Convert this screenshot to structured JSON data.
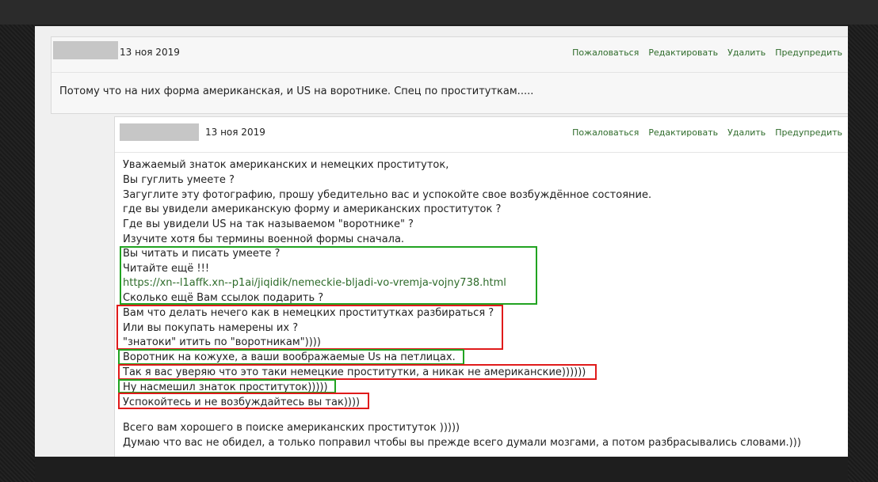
{
  "comments": [
    {
      "date": "13 ноя 2019",
      "actions": [
        "Пожаловаться",
        "Редактировать",
        "Удалить",
        "Предупредить"
      ],
      "text": "Потому что на них форма американская, и US на воротнике. Спец по проституткам....."
    },
    {
      "date": "13 ноя 2019",
      "actions": [
        "Пожаловаться",
        "Редактировать",
        "Удалить",
        "Предупредить"
      ],
      "lines": [
        "Уважаемый знаток американских и немецких проституток,",
        "Вы гуглить умеете ?",
        "Загуглите эту фотографию, прошу убедительно вас и успокойте свое возбуждённое состояние.",
        "где вы увидели американскую форму и американских проституток ?",
        "Где вы увидели US на так называемом \"воротнике\" ?",
        "Изучите хотя бы термины военной формы сначала.",
        "Вы читать и писать умеете ?",
        "Читайте ещё !!!",
        "https://xn--l1affk.xn--p1ai/jiqidik/nemeckie-bljadi-vo-vremja-vojny738.html",
        "Сколько ещё Вам ссылок подарить ?",
        "Вам что делать нечего как в немецких проститутках разбираться ?",
        "Или вы покупать намерены их ?",
        "\"знатоки\" итить по \"воротникам\"))))",
        "Воротник на кожухе, а ваши воображаемые Us на петлицах.",
        "Так я вас уверяю что это таки немецкие проститутки, а никак не американские))))))",
        "Ну насмешил знаток проституток)))))",
        "Успокойтесь и не возбуждайтесь вы так))))",
        "Всего вам хорошего в поиске американских проституток )))))",
        "Думаю что вас не обидел, а только поправил чтобы вы прежде всего думали мозгами, а потом разбрасывались словами.)))"
      ]
    }
  ],
  "colors": {
    "highlight_green": "#21a321",
    "highlight_red": "#e01b1b",
    "action_link": "#2e6b2a"
  }
}
